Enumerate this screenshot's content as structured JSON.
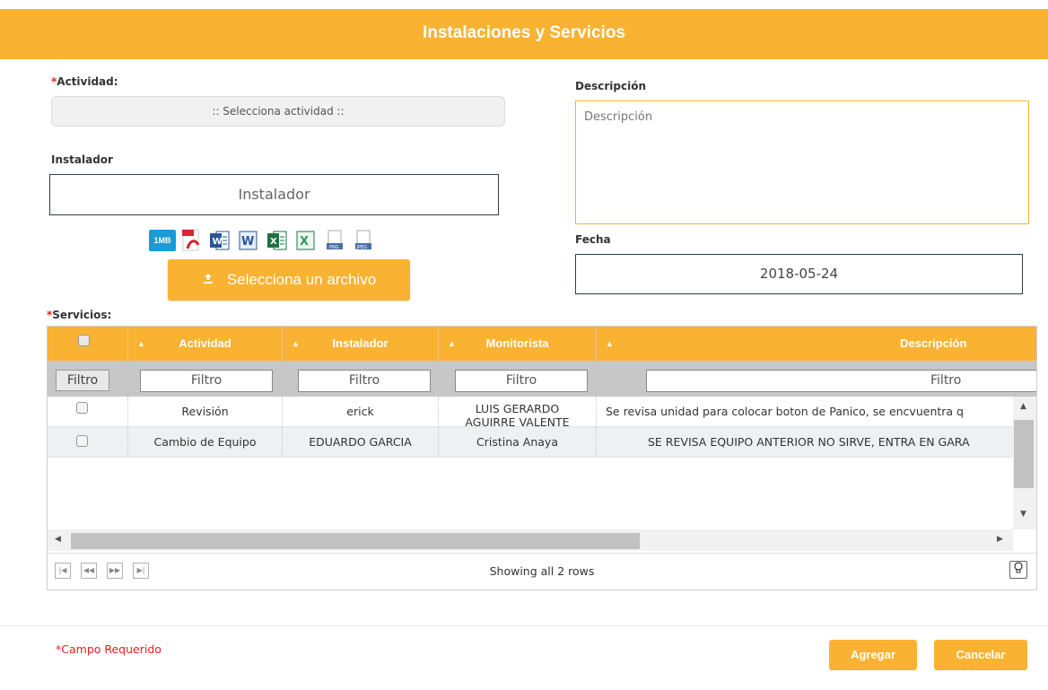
{
  "header": {
    "title": "Instalaciones y Servicios"
  },
  "form": {
    "actividad": {
      "required_mark": "*",
      "label": "Actividad:",
      "placeholder": ":: Selecciona actividad ::"
    },
    "instalador": {
      "label": "Instalador",
      "placeholder": "Instalador"
    },
    "descripcion": {
      "label": "Descripción",
      "placeholder": "Descripción"
    },
    "fecha": {
      "label": "Fecha",
      "value": "2018-05-24"
    },
    "file_types": [
      "1MB",
      "pdf",
      "doc",
      "docx",
      "xls",
      "xlsx",
      "png",
      "jpeg"
    ],
    "upload": {
      "label": "Selecciona un archivo",
      "icon": "upload-icon"
    },
    "servicios": {
      "required_mark": "*",
      "label": "Servicios:"
    }
  },
  "grid": {
    "columns": [
      "Actividad",
      "Instalador",
      "Monitorista",
      "Descripción"
    ],
    "filter_button": "Filtro",
    "filter_placeholder": "Filtro",
    "rows": [
      {
        "actividad": "Revisión",
        "instalador": "erick",
        "monitorista_line1": "LUIS GERARDO",
        "monitorista_line2": "AGUIRRE VALENTE",
        "descripcion": "Se revisa unidad para colocar boton de Panico, se encvuentra q"
      },
      {
        "actividad": "Cambio de Equipo",
        "instalador": "EDUARDO GARCIA",
        "monitorista_line1": "Cristina Anaya",
        "monitorista_line2": "",
        "descripcion": "SE REVISA EQUIPO ANTERIOR NO SIRVE, ENTRA EN GARA"
      }
    ],
    "pager_status": "Showing all 2 rows",
    "pager_buttons": [
      "first-page",
      "prev-page",
      "next-page",
      "last-page"
    ]
  },
  "footer": {
    "required_note": "*Campo Requerido",
    "add_label": "Agregar",
    "cancel_label": "Cancelar"
  },
  "colors": {
    "accent": "#f9b232",
    "required": "#e32020",
    "border_dark": "#2b3e50"
  }
}
